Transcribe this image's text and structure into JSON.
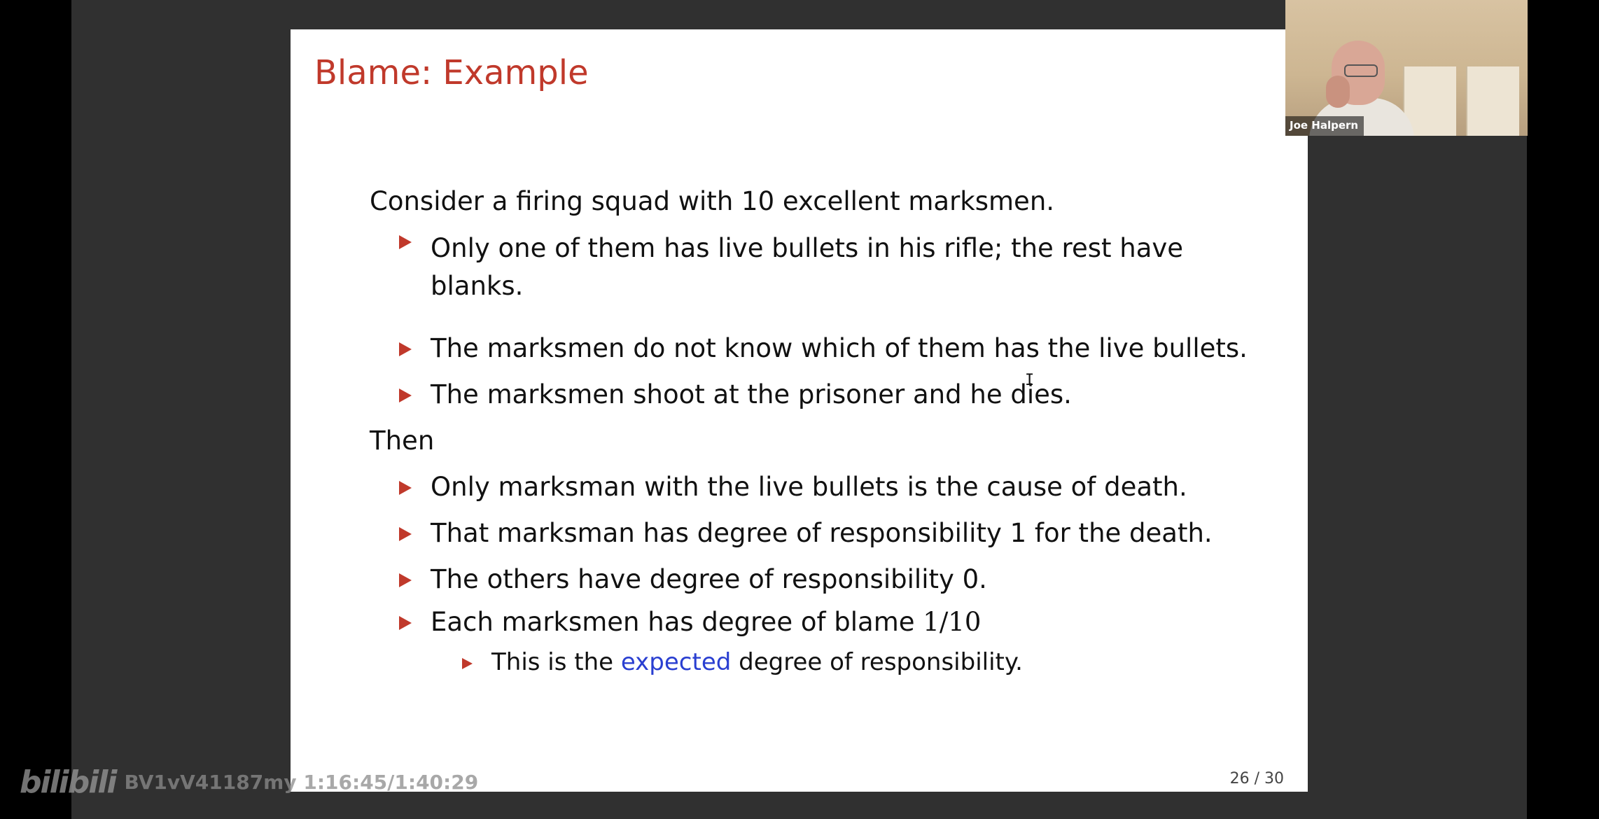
{
  "slide": {
    "title": "Blame: Example",
    "intro": "Consider a firing squad with 10 excellent marksmen.",
    "setup_items": [
      {
        "line1": "Only one of them has live bullets in his rifle; the rest have",
        "line2": "blanks."
      },
      {
        "line1": "The marksmen do not know which of them has the live bullets."
      },
      {
        "line1": "The marksmen shoot at the prisoner and he dies."
      }
    ],
    "then_label": "Then",
    "conclusion_items": [
      {
        "text": "Only marksman with the live bullets is the cause of death."
      },
      {
        "text": "That marksman has degree of responsibility 1 for the death."
      },
      {
        "text": "The others have degree of responsibility 0."
      },
      {
        "text": "Each marksmen has degree of blame ",
        "math": "1/10"
      }
    ],
    "sub_item": {
      "before": "This is the ",
      "emph": "expected",
      "after": " degree of responsibility."
    },
    "page_number": "26 / 30"
  },
  "video_tile": {
    "participant_name": "Joe Halpern"
  },
  "watermark": {
    "logo": "bilibili",
    "text": "BV1vV41187my 1:16:45/1:40:29"
  },
  "colors": {
    "title": "#c0392b",
    "bullet": "#c0392b",
    "emphasis": "#2a3fd1",
    "stage": "#303030",
    "background": "#000000"
  },
  "icons": {
    "bullet": "triangle-right-icon",
    "cursor": "text-cursor-icon"
  }
}
